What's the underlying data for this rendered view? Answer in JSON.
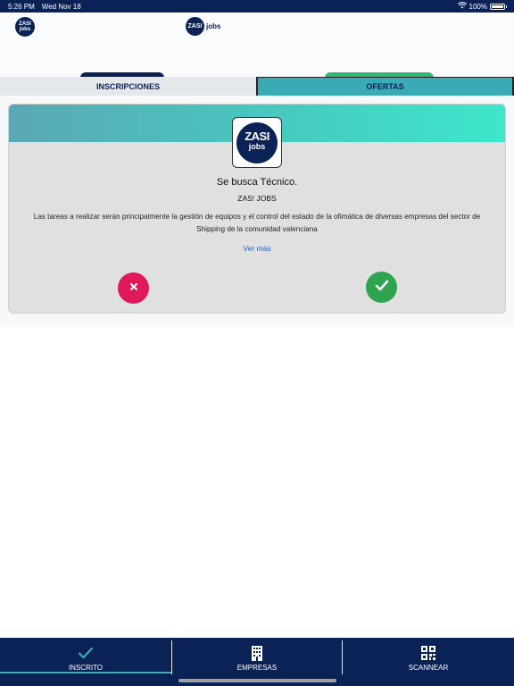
{
  "status_bar": {
    "time": "5:26 PM",
    "date": "Wed Nov 18",
    "battery": "100%"
  },
  "header": {
    "logo_small_text": "ZASI jobs",
    "logo_center_circle": "ZASI",
    "logo_center_text": "jobs"
  },
  "tabs": [
    {
      "label": "INSCRIPCIONES",
      "active": false
    },
    {
      "label": "OFERTAS",
      "active": true
    }
  ],
  "card": {
    "logo_line1": "ZASI",
    "logo_line2": "jobs",
    "title": "Se busca Técnico.",
    "company": "ZAS! JOBS",
    "description": "Las tareas a realizar serán principalmente la gestión de equipos y el control del estado de la ofimática de diversas empresas del sector de Shipping de la comunidad valenciana",
    "more_link": "Ver más",
    "reject_icon": "close-icon",
    "accept_icon": "check-icon"
  },
  "bottom_nav": [
    {
      "label": "INSCRITO",
      "icon": "check-icon",
      "active": true
    },
    {
      "label": "EMPRESAS",
      "icon": "building-icon",
      "active": false
    },
    {
      "label": "SCANNEAR",
      "icon": "qr-code-icon",
      "active": false
    }
  ],
  "colors": {
    "brand_navy": "#0b2257",
    "tab_active": "#3aaab5",
    "reject": "#e0195b",
    "accept": "#2ea44f",
    "link": "#2b5fc7"
  }
}
